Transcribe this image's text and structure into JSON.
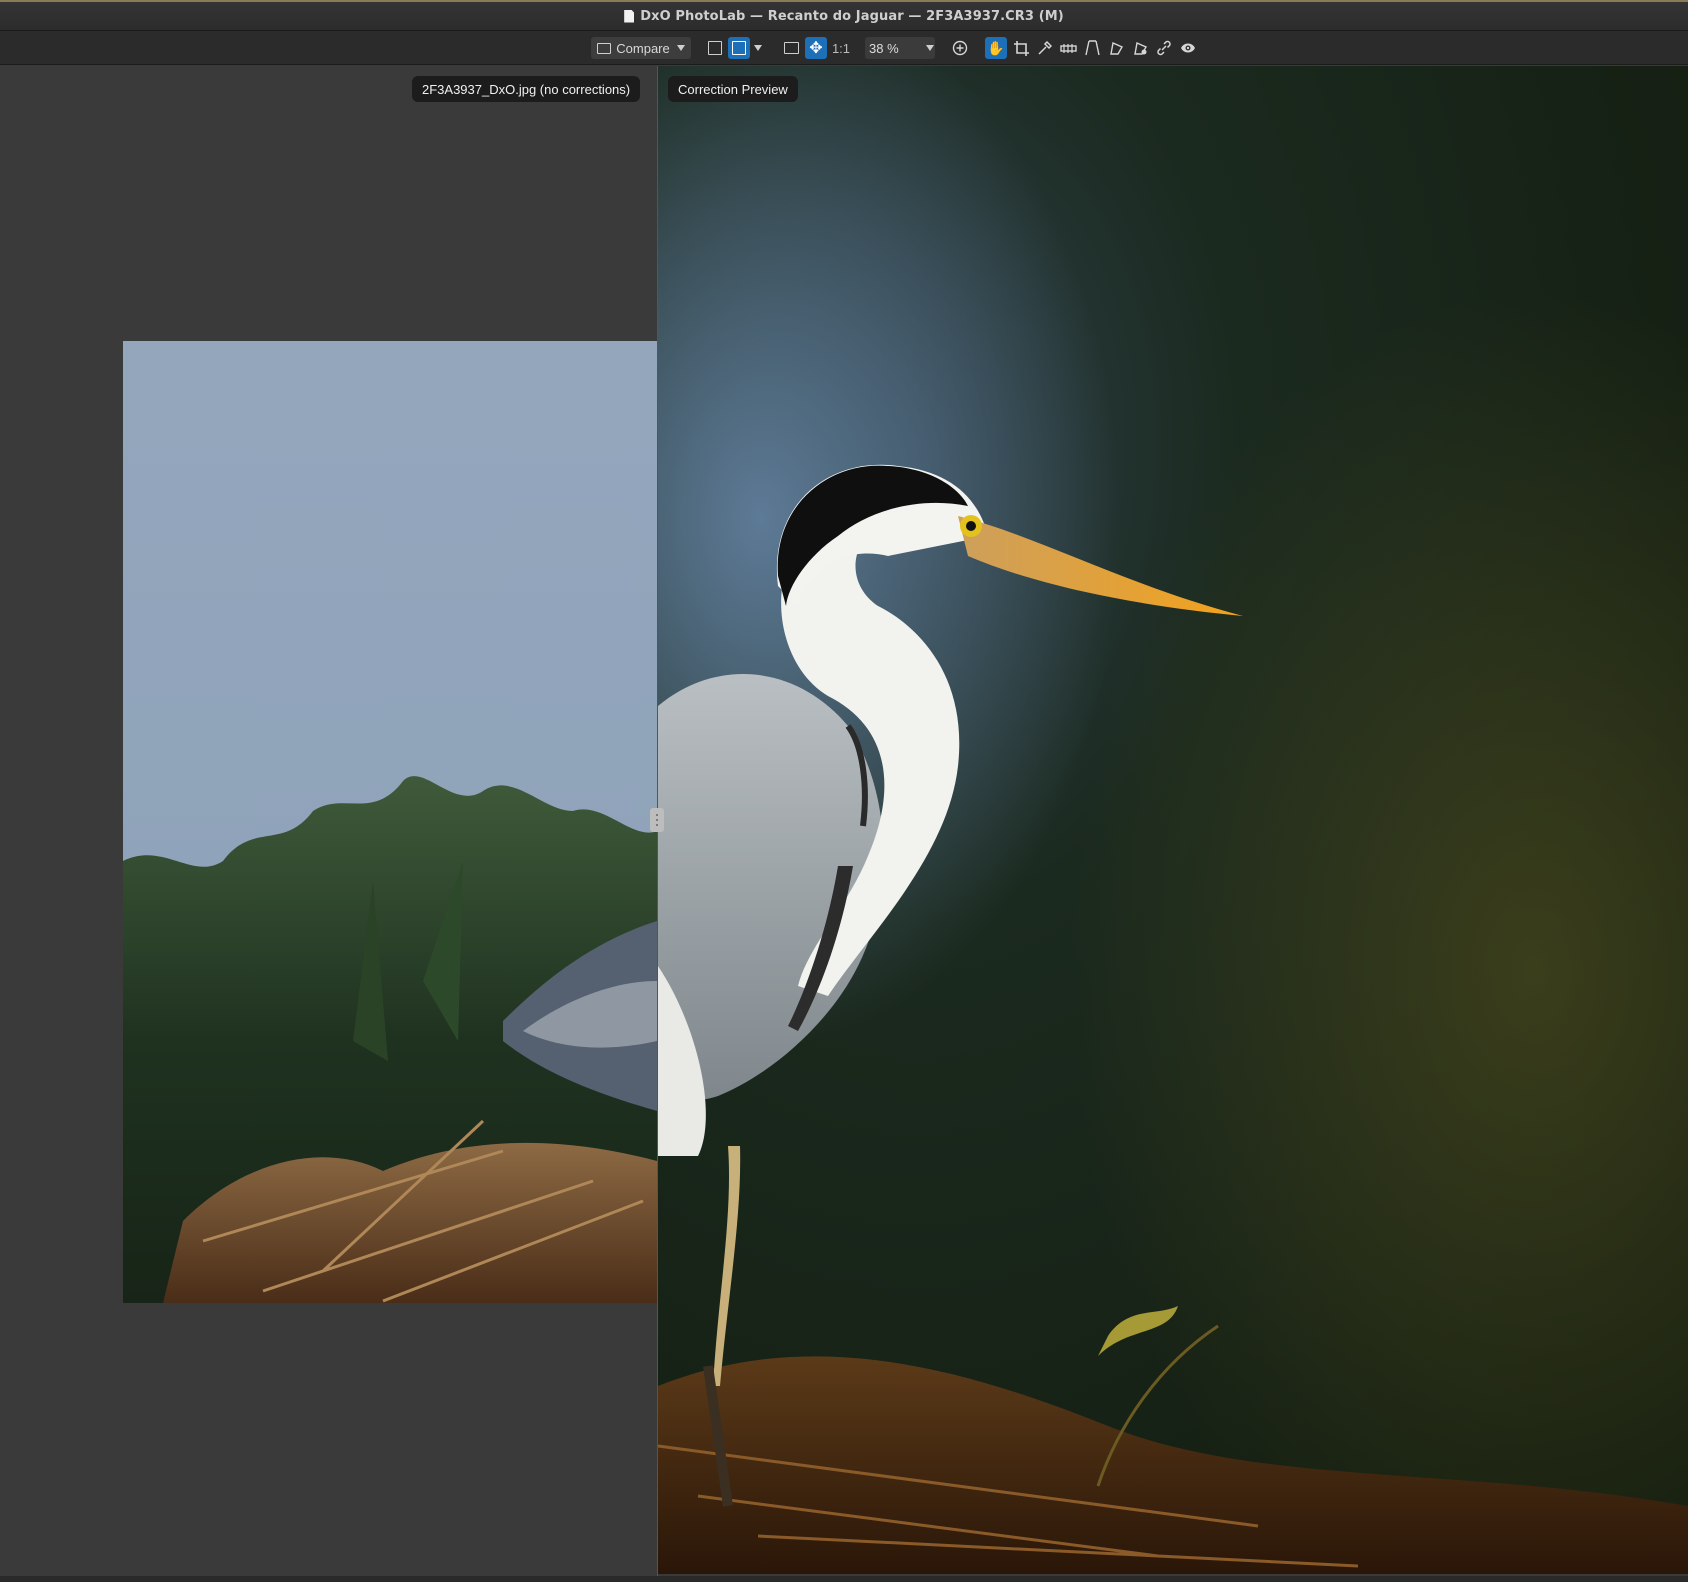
{
  "window": {
    "title": "DxO PhotoLab — Recanto do Jaguar — 2F3A3937.CR3 (M)"
  },
  "toolbar": {
    "compare_label": "Compare",
    "one_to_one": "1:1",
    "zoom_value": "38 %",
    "icons": [
      "single-view-icon",
      "split-view-icon",
      "chevron-down-icon",
      "fit-icon",
      "move-icon",
      "zoom-icon",
      "hand-icon",
      "crop-icon",
      "eyedropper-icon",
      "horizon-icon",
      "perspective-icon",
      "local-adjust-icon",
      "repair-icon",
      "link-icon",
      "eye-icon"
    ]
  },
  "viewer": {
    "left_label": "2F3A3937_DxO.jpg (no corrections)",
    "right_label": "Correction Preview"
  }
}
